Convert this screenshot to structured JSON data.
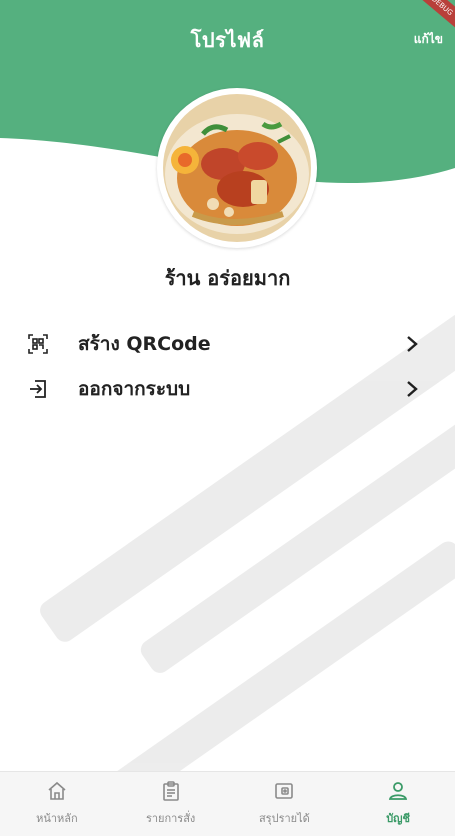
{
  "header": {
    "title": "โปรไฟล์",
    "edit_label": "แก้ไข",
    "debug_banner": "DEBUG",
    "accent_color": "#55b07f"
  },
  "profile": {
    "shop_name": "ร้าน อร่อยมาก",
    "avatar_icon": "food-photo"
  },
  "menu": {
    "items": [
      {
        "label": "สร้าง QRCode",
        "icon": "qr-code-icon",
        "chevron": "chevron-right-icon"
      },
      {
        "label": "ออกจากระบบ",
        "icon": "logout-icon",
        "chevron": "chevron-right-icon"
      }
    ]
  },
  "bottom_nav": {
    "items": [
      {
        "label": "หน้าหลัก",
        "icon": "home-icon",
        "active": false
      },
      {
        "label": "รายการสั่ง",
        "icon": "clipboard-icon",
        "active": false
      },
      {
        "label": "สรุปรายได้",
        "icon": "wallet-icon",
        "active": false
      },
      {
        "label": "บัญชี",
        "icon": "user-icon",
        "active": true
      }
    ],
    "active_color": "#3a9a67"
  }
}
